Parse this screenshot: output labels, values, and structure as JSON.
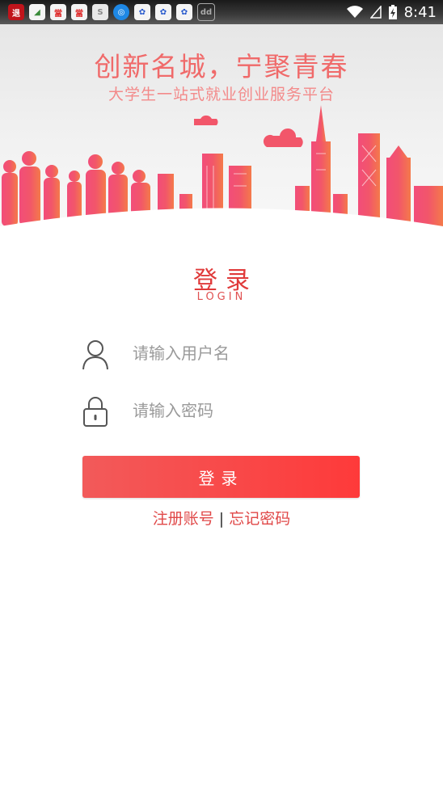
{
  "status_bar": {
    "time": "8:41",
    "notification_icons": [
      "app-icon-1",
      "app-icon-2",
      "app-icon-3",
      "app-icon-4",
      "app-icon-5",
      "app-icon-6",
      "baidu-icon",
      "baidu-icon",
      "baidu-icon",
      "app-icon-10"
    ]
  },
  "banner": {
    "slogan": "创新名城，宁聚青春",
    "subslogan": "大学生一站式就业创业服务平台"
  },
  "login": {
    "title": "登录",
    "subtitle": "LOGIN",
    "username_placeholder": "请输入用户名",
    "password_placeholder": "请输入密码",
    "button_label": "登录"
  },
  "links": {
    "register": "注册账号",
    "separator": "|",
    "forgot": "忘记密码"
  },
  "colors": {
    "accent": "#f04848",
    "slogan": "#f06a6a",
    "button_start": "#f25a5a",
    "button_end": "#fe3a3a"
  }
}
